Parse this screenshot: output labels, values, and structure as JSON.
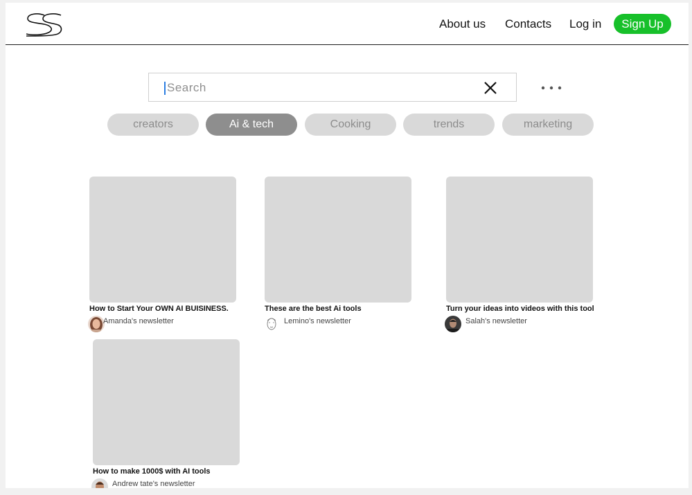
{
  "header": {
    "logo": "SS",
    "nav": {
      "about": "About us",
      "contacts": "Contacts",
      "login": "Log in",
      "signup": "Sign Up"
    },
    "accent_color": "#17c02a"
  },
  "search": {
    "placeholder": "Search",
    "value": "",
    "clear_icon": "close-icon",
    "more_icon": "more-icon"
  },
  "chips": [
    {
      "label": "creators",
      "active": false
    },
    {
      "label": "Ai & tech",
      "active": true
    },
    {
      "label": "Cooking",
      "active": false
    },
    {
      "label": "trends",
      "active": false
    },
    {
      "label": "marketing",
      "active": false
    }
  ],
  "cards": [
    {
      "title": "How to Start Your OWN AI BUISINESS.",
      "author": "Amanda's newsletter"
    },
    {
      "title": "These are the best Ai tools",
      "author": "Lemino's newsletter"
    },
    {
      "title": "Turn your ideas into videos with this tool",
      "author": "Salah's newsletter"
    },
    {
      "title": "How to make 1000$ with AI tools",
      "author": "Andrew tate's newsletter"
    }
  ]
}
